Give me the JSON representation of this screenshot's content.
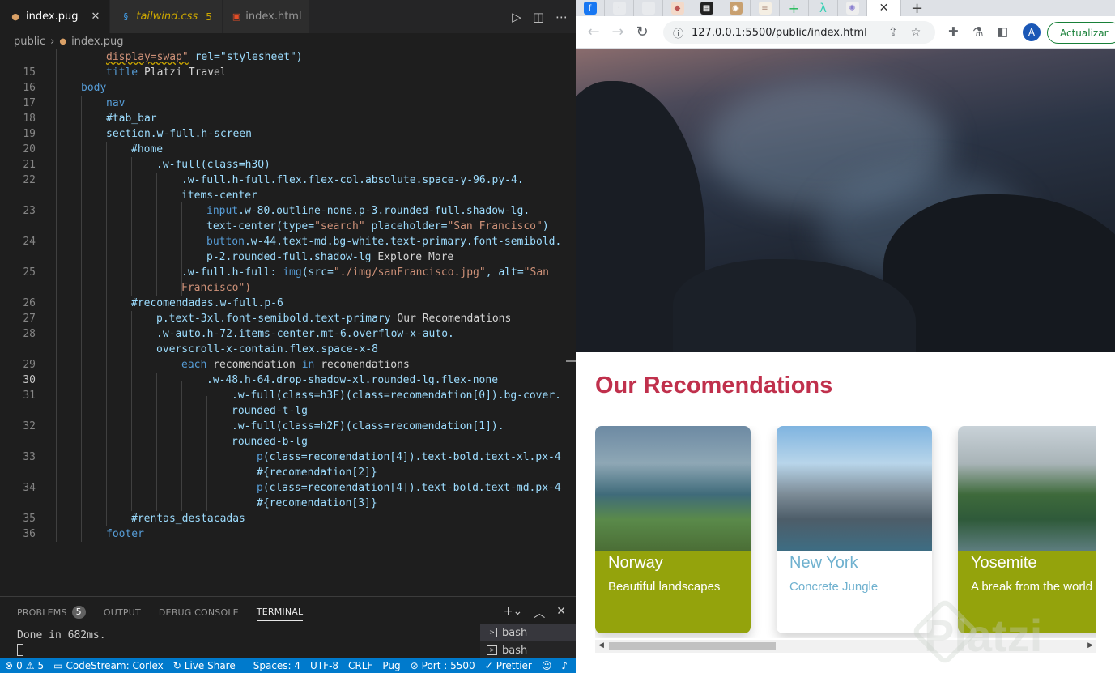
{
  "vscode": {
    "tabs": [
      {
        "label": "index.pug",
        "icon": "pug-icon"
      },
      {
        "label": "tailwind.css",
        "count": "5",
        "icon": "css-icon"
      },
      {
        "label": "index.html",
        "icon": "html-icon"
      }
    ],
    "breadcrumb": {
      "folder": "public",
      "file": "index.pug"
    },
    "line_numbers": [
      "15",
      "16",
      "17",
      "18",
      "19",
      "20",
      "21",
      "22",
      "23",
      "24",
      "25",
      "26",
      "27",
      "28",
      "29",
      "30",
      "31",
      "32",
      "33",
      "34",
      "35",
      "36"
    ],
    "code": {
      "l0_a": "display=swap\"",
      "l0_b": " rel=\"stylesheet\")",
      "l15_a": "title",
      "l15_b": " Platzi Travel",
      "l16": "body",
      "l17": "nav",
      "l18": "#tab_bar",
      "l19": "section.w-full.h-screen",
      "l20": "#home",
      "l21": ".w-full(class=h3Q)",
      "l22a": ".w-full.h-full.flex.flex-col.absolute.space-y-96.py-4.",
      "l22b": "items-center",
      "l23a_a": "input",
      "l23a_b": ".w-80.outline-none.p-3.rounded-full.shadow-lg.",
      "l23b_a": "text-center(type=",
      "l23b_b": "\"search\"",
      "l23b_c": " placeholder=",
      "l23b_d": "\"San Francisco\"",
      "l23b_e": ")",
      "l24a_a": "button",
      "l24a_b": ".w-44.text-md.bg-white.text-primary.font-semibold.",
      "l24b_a": "p-2.rounded-full.shadow-lg",
      "l24b_b": " Explore More",
      "l25a_a": ".w-full.h-full: ",
      "l25a_b": "img",
      "l25a_c": "(src=",
      "l25a_d": "\"./img/sanFrancisco.jpg\"",
      "l25a_e": ", alt=",
      "l25a_f": "\"San",
      "l25b": "Francisco\")",
      "l26": "#recomendadas.w-full.p-6",
      "l27_a": "p.text-3xl.font-semibold.text-primary",
      "l27_b": " Our Recomendations",
      "l28a": ".w-auto.h-72.items-center.mt-6.overflow-x-auto.",
      "l28b": "overscroll-x-contain.flex.space-x-8",
      "l29_a": "each",
      "l29_b": " recomendation ",
      "l29_c": "in",
      "l29_d": " recomendations",
      "l30": ".w-48.h-64.drop-shadow-xl.rounded-lg.flex-none",
      "l31a": ".w-full(class=h3F)(class=recomendation[0]).bg-cover.",
      "l31b": "rounded-t-lg",
      "l32a": ".w-full(class=h2F)(class=recomendation[1]).",
      "l32b": "rounded-b-lg",
      "l33a_a": "p",
      "l33a_b": "(class=recomendation[4]).text-bold.text-xl.px-4",
      "l33b": "#{recomendation[2]}",
      "l34a_a": "p",
      "l34a_b": "(class=recomendation[4]).text-bold.text-md.px-4",
      "l34b": "#{recomendation[3]}",
      "l35": "#rentas_destacadas",
      "l36": "footer"
    },
    "panel": {
      "tabs": [
        "PROBLEMS",
        "OUTPUT",
        "DEBUG CONSOLE",
        "TERMINAL"
      ],
      "problems_count": "5",
      "terminal_output": "Done in 682ms.",
      "terminals": [
        "bash",
        "bash"
      ]
    },
    "statusbar": {
      "errors": "0",
      "warnings": "5",
      "codestream": "CodeStream: Corlex",
      "liveshare": "Live Share",
      "spaces": "Spaces: 4",
      "encoding": "UTF-8",
      "eol": "CRLF",
      "language": "Pug",
      "port": "Port : 5500",
      "prettier": "Prettier"
    }
  },
  "chrome": {
    "url": "127.0.0.1:5500/public/index.html",
    "avatar": "A",
    "update_label": "Actualizar",
    "page": {
      "section_title": "Our Recomendations",
      "cards": [
        {
          "title": "Norway",
          "subtitle": "Beautiful landscapes",
          "bg": "#94a30c",
          "text_color": "#ffffff"
        },
        {
          "title": "New York",
          "subtitle": "Concrete Jungle",
          "bg": "#ffffff",
          "text_color": "#6fb1cf"
        },
        {
          "title": "Yosemite",
          "subtitle": "A break from the world",
          "bg": "#94a30c",
          "text_color": "#ffffff"
        }
      ],
      "watermark": "Platzi"
    }
  }
}
